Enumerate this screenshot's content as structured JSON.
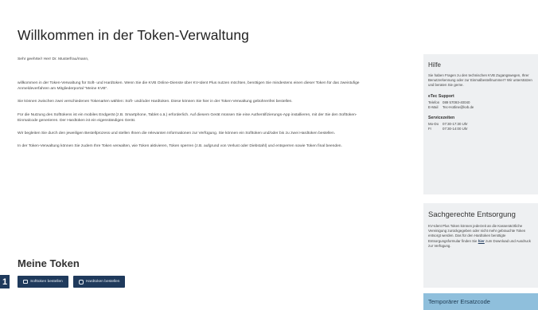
{
  "page": {
    "title": "Willkommen in der Token-Verwaltung",
    "greeting": "Sehr geehrte/r Herr Dr. Musterfrau/mann,",
    "paragraphs": [
      "willkommen in der Token-Verwaltung für Soft- und Hardtoken. Wenn Sie die KVB Online-Dienste über KV-Ident Plus nutzen möchten, benötigen Sie mindestens einen dieser Token für das zweistufige Anmeldeverfahren am Mitgliederportal \"Meine KVB\".",
      "Sie können zwischen zwei verschiedenen Tokenarten wählen: Soft- und/oder Hardtoken. Diese können Sie hier in der Token-Verwaltung gebührenfrei bestellen.",
      "Für die Nutzung des Softtokens ist ein mobiles Endgerät (z.B. Smartphone, Tablet o.ä.) erforderlich. Auf diesem Gerät müssen Sie eine Authentifizierungs-App installieren, mit der Sie den Softtoken-Einmalcode generieren. Der Hardtoken ist ein eigenständiges Gerät.",
      "Wir begleiten Sie durch den jeweiligen Bestellprozess und stellen Ihnen die relevanten Informationen zur Verfügung. Sie können ein Softtoken und/oder bis zu zwei Hardtoken bestellen.",
      "In der Token-Verwaltung können Sie zudem Ihre Token verwalten, wie Token aktivieren, Token sperren (z.B. aufgrund von Verlust oder Diebstahl) und entsperren sowie Token final beenden."
    ],
    "section_title": "Meine Token",
    "buttons": {
      "softtoken": "Softtoken bestellen",
      "hardtoken": "Hardtoken bestellen"
    },
    "marker": "1"
  },
  "sidebar": {
    "help": {
      "title": "Hilfe",
      "text": "Sie haben Fragen zu den technischen KVB Zugangswegen, Ihrer Benutzerkennung oder zur Einmalbestellnummer? Wir unterstützen und beraten Sie gerne.",
      "support_title": "eTec Support",
      "phone_label": "Telefon",
      "phone": "089 57093-40040",
      "email_label": "E-Mail",
      "email": "Tec-Hotline@kvb.de",
      "hours_title": "Servicezeiten",
      "hours": [
        {
          "days": "Mo-Do",
          "time": "07:30-17:30 Uhr"
        },
        {
          "days": "Fr",
          "time": "07:30-14:00 Uhr"
        }
      ]
    },
    "complaint": {
      "title": "Sachgerechte Entsorgung",
      "text": "KV-Ident Plus Token können jederzeit an die Kassenärztliche Vereinigung zurückgegeben oder nicht mehr gebrauchte Token entsorgt werden. Das für den Hardtoken benötigte Entsorgungsformular finden Sie",
      "link": "hier",
      "text_after": "zum Download und Ausdruck zur Verfügung."
    },
    "code": {
      "title": "Temporärer Ersatzcode"
    }
  }
}
